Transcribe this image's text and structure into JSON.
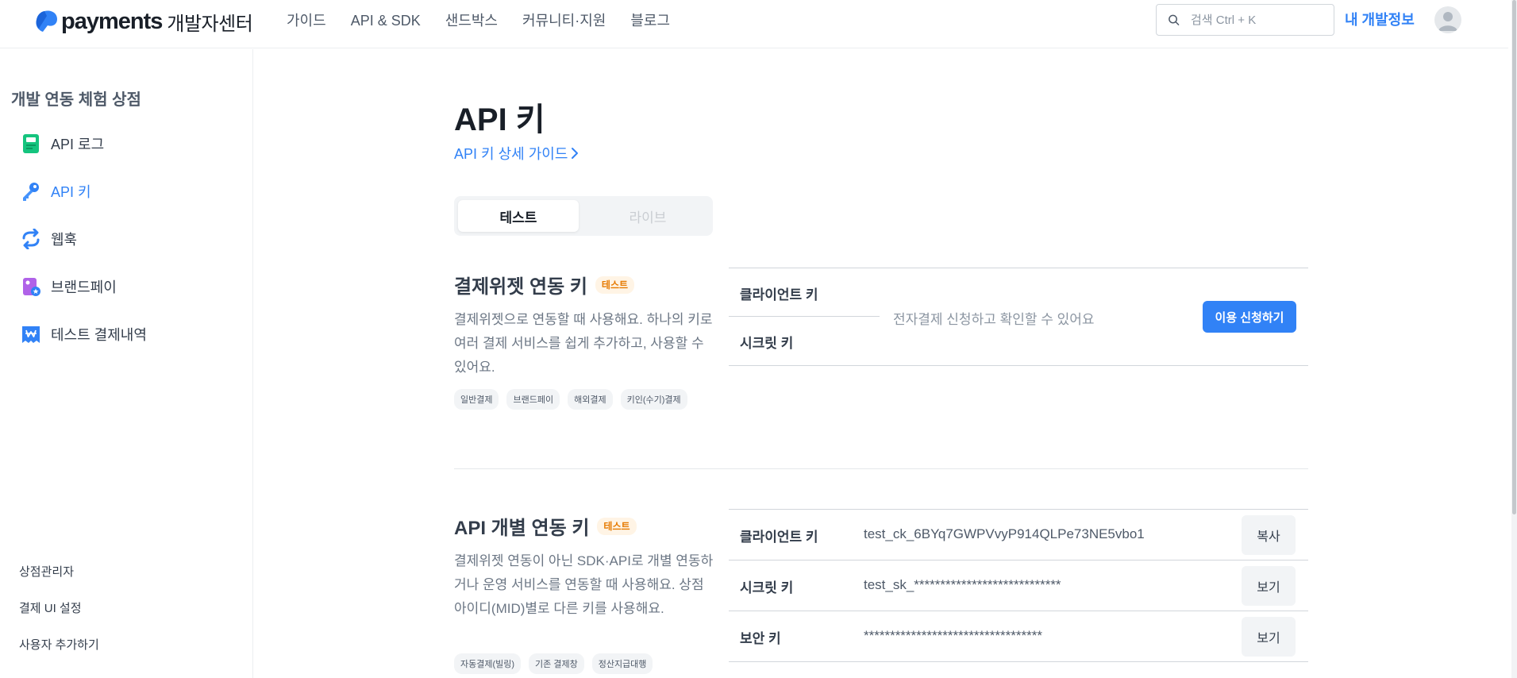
{
  "header": {
    "logo_text": "payments",
    "logo_sub": "개발자센터",
    "nav": [
      "가이드",
      "API & SDK",
      "샌드박스",
      "커뮤니티·지원",
      "블로그"
    ],
    "search_placeholder": "검색 Ctrl + K",
    "my_dev_label": "내 개발정보"
  },
  "sidebar": {
    "store_title": "개발 연동 체험 상점",
    "items": [
      {
        "label": "API 로그",
        "icon": "log-icon"
      },
      {
        "label": "API 키",
        "icon": "key-icon",
        "active": true
      },
      {
        "label": "웹훅",
        "icon": "webhook-icon"
      },
      {
        "label": "브랜드페이",
        "icon": "brandpay-icon"
      },
      {
        "label": "테스트 결제내역",
        "icon": "receipt-icon"
      }
    ],
    "bottom_links": [
      "상점관리자",
      "결제 UI 설정",
      "사용자 추가하기"
    ]
  },
  "main": {
    "title": "API 키",
    "guide_link": "API 키 상세 가이드",
    "tabs": [
      {
        "label": "테스트",
        "selected": true
      },
      {
        "label": "라이브",
        "selected": false
      }
    ],
    "widget_section": {
      "title": "결제위젯 연동 키",
      "badge": "테스트",
      "description": "결제위젯으로 연동할 때 사용해요. 하나의 키로 여러 결제 서비스를 쉽게 추가하고, 사용할 수 있어요.",
      "tags": [
        "일반결제",
        "브랜드페이",
        "해외결제",
        "키인(수기)결제"
      ],
      "client_key_label": "클라이언트 키",
      "secret_key_label": "시크릿 키",
      "message": "전자결제 신청하고 확인할 수 있어요",
      "apply_button": "이용 신청하기"
    },
    "api_section": {
      "title": "API 개별 연동 키",
      "badge": "테스트",
      "description": "결제위젯 연동이 아닌 SDK·API로 개별 연동하거나 운영 서비스를 연동할 때 사용해요. 상점아이디(MID)별로 다른 키를 사용해요.",
      "tags": [
        "자동결제(빌링)",
        "기존 결제창",
        "정산지급대행"
      ],
      "rows": [
        {
          "label": "클라이언트 키",
          "value": "test_ck_6BYq7GWPVvyP914QLPe73NE5vbo1",
          "button": "복사"
        },
        {
          "label": "시크릿 키",
          "value": "test_sk_****************************",
          "button": "보기"
        },
        {
          "label": "보안 키",
          "value": "**********************************",
          "button": "보기"
        }
      ]
    }
  },
  "colors": {
    "accent": "#3182f6",
    "badge_text": "#e67a00",
    "badge_bg": "#fff4e5"
  }
}
